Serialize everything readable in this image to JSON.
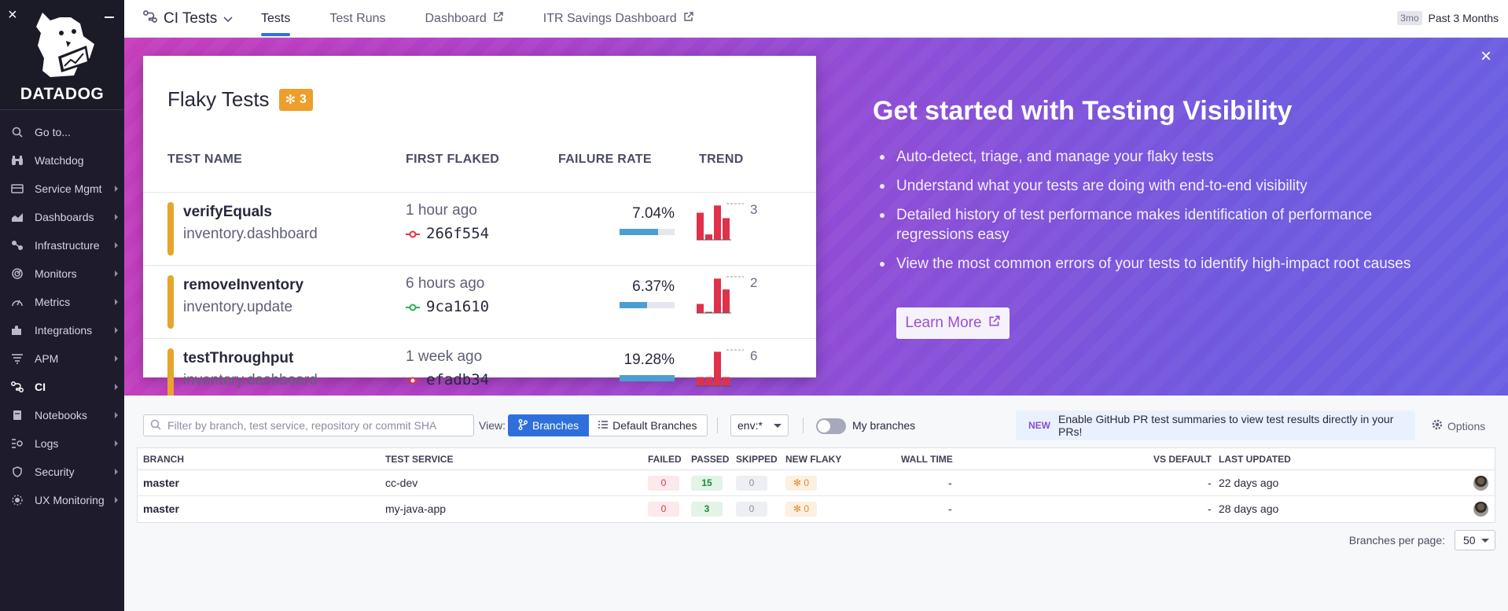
{
  "sidebar": {
    "logo_text": "DATADOG",
    "items": [
      {
        "label": "Go to...",
        "icon": "search-icon",
        "arrow": false
      },
      {
        "label": "Watchdog",
        "icon": "binoculars-icon",
        "arrow": false
      },
      {
        "label": "Service Mgmt",
        "icon": "service-icon",
        "arrow": true
      },
      {
        "label": "Dashboards",
        "icon": "chart-icon",
        "arrow": true
      },
      {
        "label": "Infrastructure",
        "icon": "nodes-icon",
        "arrow": true
      },
      {
        "label": "Monitors",
        "icon": "radar-icon",
        "arrow": true
      },
      {
        "label": "Metrics",
        "icon": "gauge-icon",
        "arrow": true
      },
      {
        "label": "Integrations",
        "icon": "puzzle-icon",
        "arrow": true
      },
      {
        "label": "APM",
        "icon": "list-icon",
        "arrow": true
      },
      {
        "label": "CI",
        "icon": "ci-icon",
        "arrow": true
      },
      {
        "label": "Notebooks",
        "icon": "notebook-icon",
        "arrow": true
      },
      {
        "label": "Logs",
        "icon": "logs-icon",
        "arrow": true
      },
      {
        "label": "Security",
        "icon": "shield-icon",
        "arrow": true
      },
      {
        "label": "UX Monitoring",
        "icon": "ux-icon",
        "arrow": true
      }
    ]
  },
  "topbar": {
    "app_name": "CI Tests",
    "tabs": [
      {
        "label": "Tests",
        "external": false
      },
      {
        "label": "Test Runs",
        "external": false
      },
      {
        "label": "Dashboard",
        "external": true
      },
      {
        "label": "ITR Savings Dashboard",
        "external": true
      }
    ],
    "time_badge": "3mo",
    "time_label": "Past 3 Months"
  },
  "flaky_card": {
    "title": "Flaky Tests",
    "badge_count": "3",
    "columns": [
      "TEST NAME",
      "FIRST FLAKED",
      "FAILURE RATE",
      "TREND"
    ],
    "rows": [
      {
        "name": "verifyEquals",
        "service": "inventory.dashboard",
        "when": "1 hour ago",
        "commit": "266f554",
        "commit_status": "fail",
        "rate": "7.04%",
        "rate_fraction": 0.704,
        "trend_count": "3",
        "trend_bars": [
          0.75,
          0.15,
          0.95,
          0.6
        ]
      },
      {
        "name": "removeInventory",
        "service": "inventory.update",
        "when": "6 hours ago",
        "commit": "9ca1610",
        "commit_status": "pass",
        "rate": "6.37%",
        "rate_fraction": 0.5,
        "trend_count": "2",
        "trend_bars": [
          0.25,
          0.0,
          0.95,
          0.65
        ]
      },
      {
        "name": "testThroughput",
        "service": "inventory.dashboard",
        "when": "1 week ago",
        "commit": "efadb34",
        "commit_status": "fail",
        "rate": "19.28%",
        "rate_fraction": 1.0,
        "trend_count": "6",
        "trend_bars": [
          0.25,
          0.25,
          0.95,
          0.25
        ]
      }
    ]
  },
  "promo": {
    "title": "Get started with Testing Visibility",
    "bullets": [
      "Auto-detect, triage, and manage your flaky tests",
      "Understand what your tests are doing with end-to-end visibility",
      "Detailed history of test performance makes identification of performance regressions easy",
      "View the most common errors of your tests to identify high-impact root causes"
    ],
    "button": "Learn More"
  },
  "filters": {
    "search_placeholder": "Filter by branch, test service, repository or commit SHA",
    "view_label": "View:",
    "view_options": [
      "Branches",
      "Default Branches"
    ],
    "env_value": "env:*",
    "toggle_label": "My branches",
    "note_tag": "NEW",
    "note_text": "Enable GitHub PR test summaries to view test results directly in your PRs!",
    "options_label": "Options"
  },
  "table": {
    "headers": [
      "BRANCH",
      "TEST SERVICE",
      "FAILED",
      "PASSED",
      "SKIPPED",
      "NEW FLAKY",
      "WALL TIME",
      "VS DEFAULT",
      "LAST UPDATED"
    ],
    "rows": [
      {
        "branch": "master",
        "service": "cc-dev",
        "failed": "0",
        "passed": "15",
        "skipped": "0",
        "new_flaky": "0",
        "wall_time": "-",
        "vs_default": "-",
        "updated": "22 days ago"
      },
      {
        "branch": "master",
        "service": "my-java-app",
        "failed": "0",
        "passed": "3",
        "skipped": "0",
        "new_flaky": "0",
        "wall_time": "-",
        "vs_default": "-",
        "updated": "28 days ago"
      }
    ]
  },
  "pager": {
    "label": "Branches per page:",
    "value": "50"
  },
  "colors": {
    "accent": "#2f6fdc",
    "flaky": "#ed9e2b",
    "fail": "#e0314a",
    "pass": "#2fb152",
    "banner_start": "#c63fbd",
    "banner_end": "#6a5fe2"
  }
}
